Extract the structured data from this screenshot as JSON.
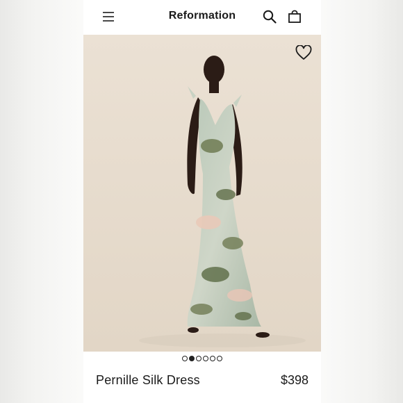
{
  "header": {
    "brand": "Reformation",
    "icons": [
      "menu-icon",
      "search-icon",
      "shopping-bag-icon"
    ]
  },
  "product": {
    "name": "Pernille Silk Dress",
    "price": "$398",
    "favorite_icon": "heart-outline-icon"
  },
  "carousel": {
    "total": 6,
    "active_index": 1
  },
  "colors": {
    "background": "#ffffff",
    "image_backdrop": "#ebe1d4",
    "text": "#1a1a1a"
  }
}
